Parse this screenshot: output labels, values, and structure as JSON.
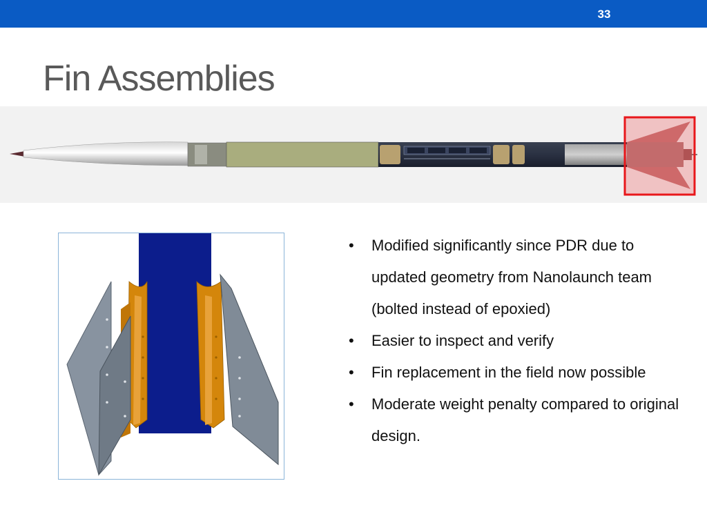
{
  "slide": {
    "page_number": "33",
    "title": "Fin Assemblies"
  },
  "colors": {
    "header_bar": "#0a5bc4",
    "title_text": "#595959",
    "highlight_box": "#e8171b",
    "tube_blue": "#0c1d8c",
    "fin_gray": "#7d8a95",
    "bracket_gold": "#d4860b"
  },
  "bullets": [
    {
      "text": "Modified significantly since PDR due to updated geometry from Nanolaunch team (bolted instead of epoxied)"
    },
    {
      "text": "Easier to inspect and verify"
    },
    {
      "text": "Fin replacement in the field now possible"
    },
    {
      "text": "Moderate weight penalty compared to original design."
    }
  ]
}
